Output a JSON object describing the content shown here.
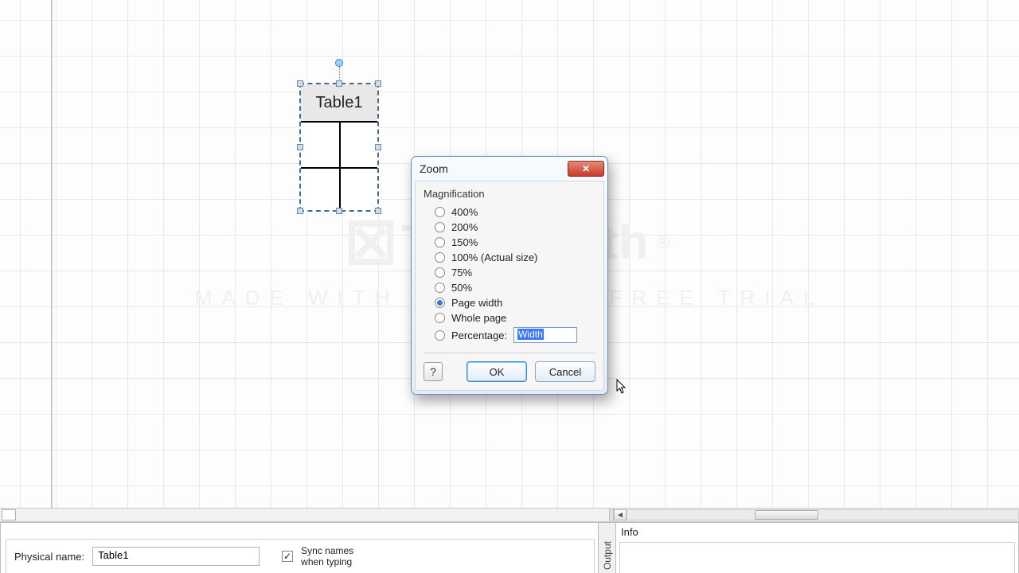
{
  "canvas": {
    "shape_label": "Table1"
  },
  "watermark": {
    "brand": "TechSmith",
    "reg": "®",
    "tagline": "MADE WITH CAMTASIA FREE TRIAL"
  },
  "zoom_dialog": {
    "title": "Zoom",
    "group": "Magnification",
    "options": {
      "o400": "400%",
      "o200": "200%",
      "o150": "150%",
      "o100": "100% (Actual size)",
      "o75": "75%",
      "o50": "50%",
      "page_width": "Page width",
      "whole_page": "Whole page",
      "percentage_label": "Percentage:"
    },
    "percentage_value": "Width",
    "ok": "OK",
    "cancel": "Cancel"
  },
  "bottom": {
    "physical_name_label": "Physical name:",
    "physical_name_value": "Table1",
    "sync_line1": "Sync names",
    "sync_line2": "when typing",
    "output_tab": "Output",
    "info_title": "Info"
  }
}
